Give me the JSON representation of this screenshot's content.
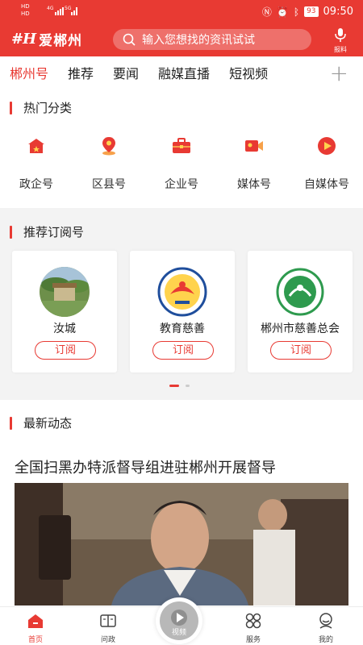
{
  "status": {
    "left_top": "HD",
    "left_bottom": "HD",
    "net_a": "4G",
    "net_b": "5G",
    "battery": "93",
    "time": "09:50"
  },
  "header": {
    "logo_mark": "#H",
    "logo_text": "爱郴州",
    "search_placeholder": "输入您想找的资讯试试",
    "report_label": "报料"
  },
  "tabs": [
    "郴州号",
    "推荐",
    "要闻",
    "融媒直播",
    "短视频"
  ],
  "hot": {
    "title": "热门分类",
    "items": [
      {
        "label": "政企号",
        "icon": "government-building-icon"
      },
      {
        "label": "区县号",
        "icon": "location-pin-icon"
      },
      {
        "label": "企业号",
        "icon": "briefcase-icon"
      },
      {
        "label": "媒体号",
        "icon": "video-camera-icon"
      },
      {
        "label": "自媒体号",
        "icon": "play-circle-icon"
      }
    ]
  },
  "recommend": {
    "title": "推荐订阅号",
    "subscribe_label": "订阅",
    "accounts": [
      {
        "name": "汝城"
      },
      {
        "name": "教育慈善"
      },
      {
        "name": "郴州市慈善总会"
      }
    ]
  },
  "latest": {
    "title": "最新动态",
    "headline": "全国扫黑办特派督导组进驻郴州开展督导"
  },
  "bottom_nav": {
    "home": "首页",
    "ask": "问政",
    "video": "视频",
    "service": "服务",
    "mine": "我的"
  },
  "colors": {
    "accent": "#e83a33",
    "band": "#f3f3f3"
  }
}
